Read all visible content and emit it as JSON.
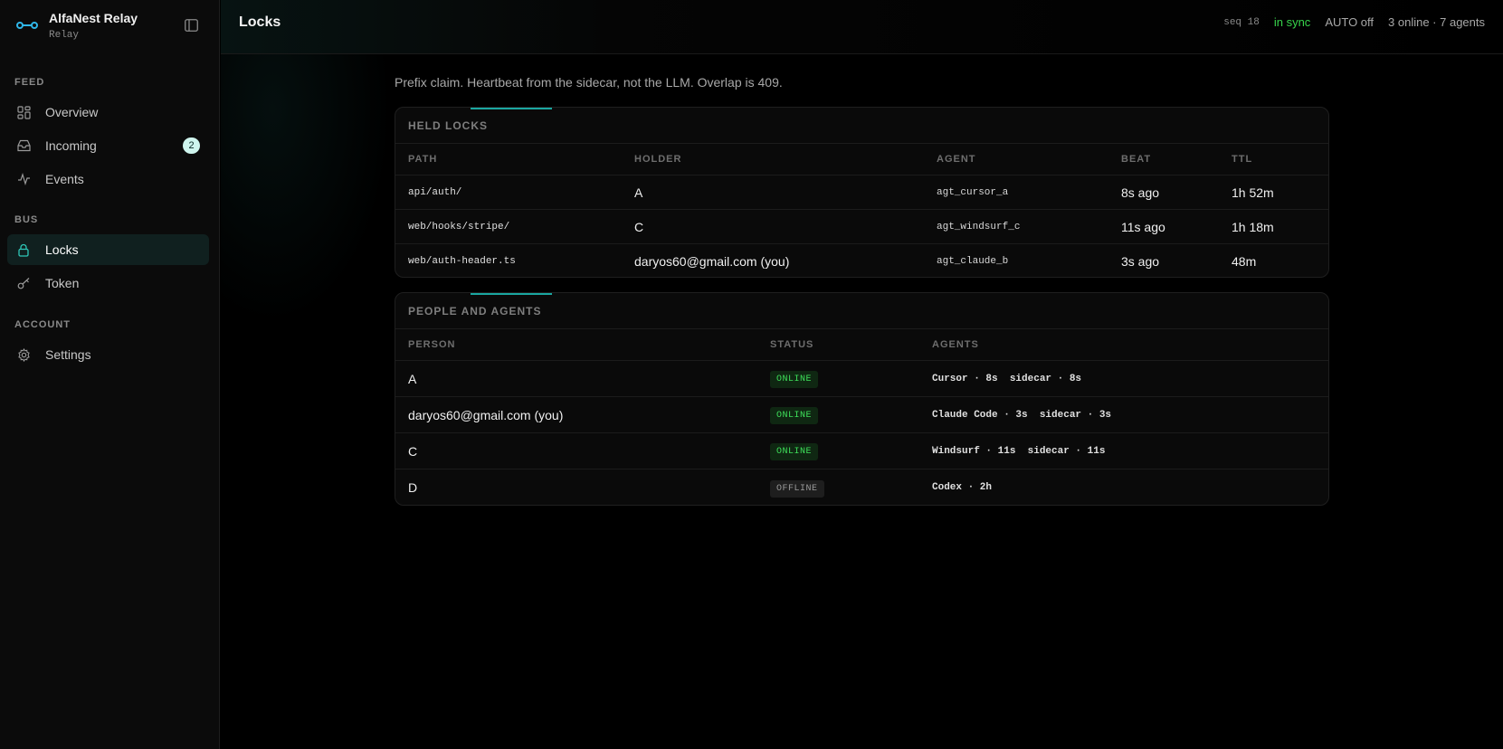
{
  "app": {
    "name": "AlfaNest Relay",
    "subtitle": "Relay"
  },
  "sidebar": {
    "sections": [
      {
        "label": "FEED"
      },
      {
        "label": "BUS"
      },
      {
        "label": "ACCOUNT"
      }
    ],
    "items": [
      {
        "label": "Overview",
        "icon": "grid-icon"
      },
      {
        "label": "Incoming",
        "icon": "inbox-icon",
        "badge": "2"
      },
      {
        "label": "Events",
        "icon": "activity-icon"
      },
      {
        "label": "Locks",
        "icon": "lock-icon",
        "active": true
      },
      {
        "label": "Token",
        "icon": "key-icon"
      },
      {
        "label": "Settings",
        "icon": "gear-icon"
      }
    ]
  },
  "header": {
    "title": "Locks",
    "seq": "seq 18",
    "sync": "in sync",
    "auto": "AUTO off",
    "presence": "3 online · 7 agents"
  },
  "intro": "Prefix claim. Heartbeat from the sidecar, not the LLM. Overlap is 409.",
  "locks": {
    "title": "HELD LOCKS",
    "columns": [
      "PATH",
      "HOLDER",
      "AGENT",
      "BEAT",
      "TTL"
    ],
    "rows": [
      {
        "path": "api/auth/",
        "holder": "A",
        "agent": "agt_cursor_a",
        "beat": "8s ago",
        "ttl": "1h 52m"
      },
      {
        "path": "web/hooks/stripe/",
        "holder": "C",
        "agent": "agt_windsurf_c",
        "beat": "11s ago",
        "ttl": "1h 18m"
      },
      {
        "path": "web/auth-header.ts",
        "holder": "daryos60@gmail.com (you)",
        "agent": "agt_claude_b",
        "beat": "3s ago",
        "ttl": "48m"
      }
    ]
  },
  "people": {
    "title": "PEOPLE AND AGENTS",
    "columns": [
      "PERSON",
      "STATUS",
      "AGENTS"
    ],
    "rows": [
      {
        "person": "A",
        "status": "ONLINE",
        "agents": "Cursor · 8s  sidecar · 8s"
      },
      {
        "person": "daryos60@gmail.com (you)",
        "status": "ONLINE",
        "agents": "Claude Code · 3s  sidecar · 3s"
      },
      {
        "person": "C",
        "status": "ONLINE",
        "agents": "Windsurf · 11s  sidecar · 11s"
      },
      {
        "person": "D",
        "status": "OFFLINE",
        "agents": "Codex · 2h"
      }
    ]
  },
  "colors": {
    "accent": "#1aa7a1",
    "online": "#3ee05a",
    "sync": "#37d44b"
  }
}
